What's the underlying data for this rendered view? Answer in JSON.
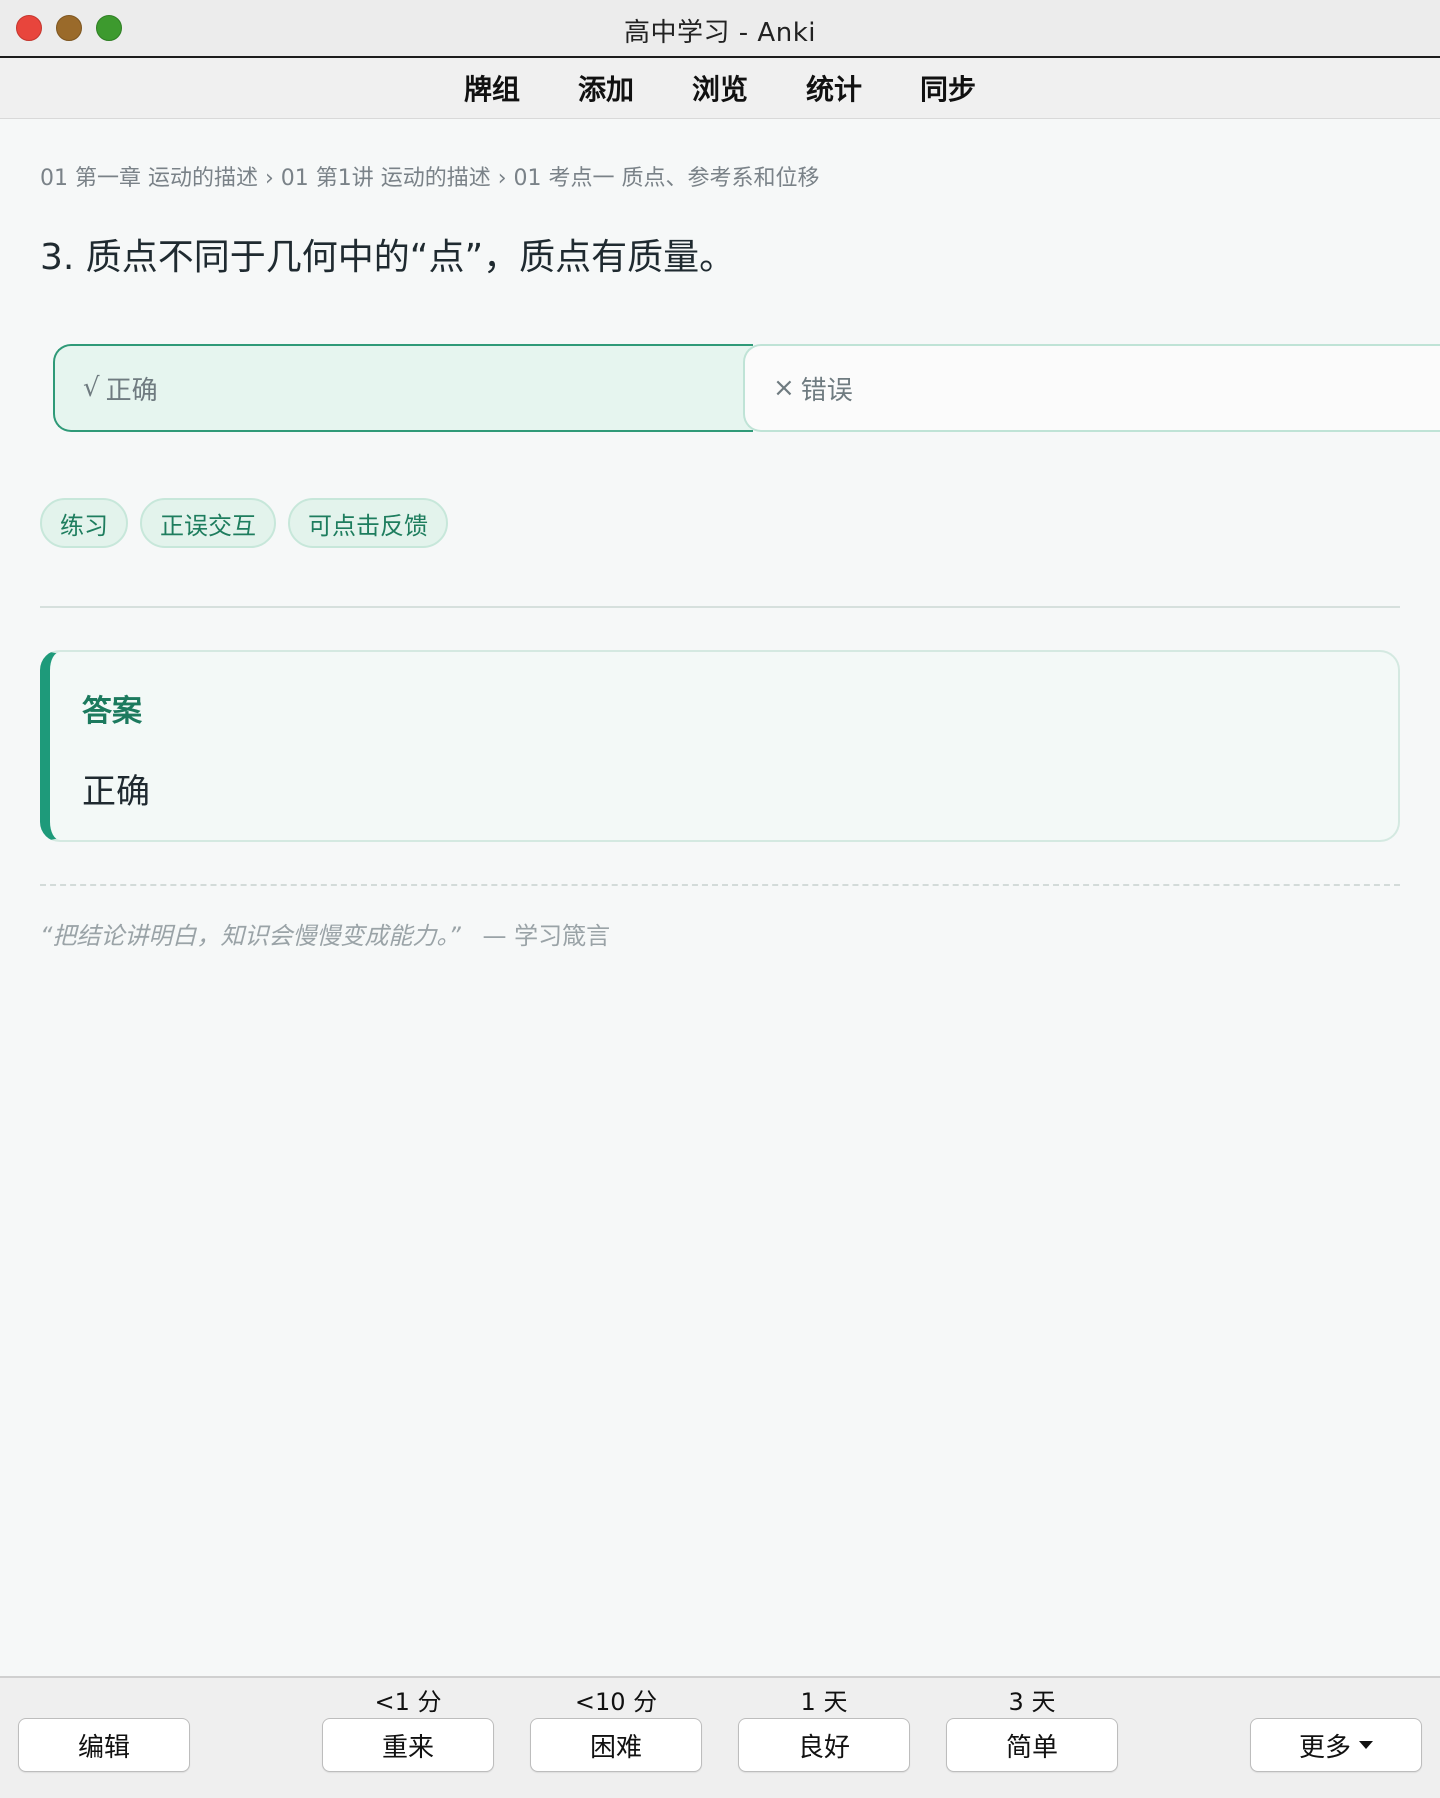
{
  "window": {
    "title": "高中学习 - Anki"
  },
  "toolbar": {
    "items": [
      "牌组",
      "添加",
      "浏览",
      "统计",
      "同步"
    ]
  },
  "card": {
    "breadcrumb": "01 第一章 运动的描述 › 01 第1讲 运动的描述 › 01 考点一 质点、参考系和位移",
    "question": "3.  质点不同于几何中的“点”，质点有质量。",
    "choices": {
      "correct": {
        "mark": "√",
        "label": "正确"
      },
      "wrong": {
        "mark": "×",
        "label": "错误"
      }
    },
    "tags": [
      "练习",
      "正误交互",
      "可点击反馈"
    ],
    "answer": {
      "label": "答案",
      "value": "正确"
    },
    "quote": {
      "text": "“把结论讲明白，知识会慢慢变成能力。”",
      "source": "— 学习箴言"
    }
  },
  "bottombar": {
    "edit_label": "编辑",
    "more_label": "更多",
    "ease_buttons": [
      {
        "interval": "<1 分",
        "label": "重来"
      },
      {
        "interval": "<10 分",
        "label": "困难"
      },
      {
        "interval": "1 天",
        "label": "良好"
      },
      {
        "interval": "3 天",
        "label": "简单"
      }
    ]
  },
  "colors": {
    "accent": "#1e9a7a",
    "tag_text": "#1e7d5e",
    "background": "#f6f8f8"
  }
}
